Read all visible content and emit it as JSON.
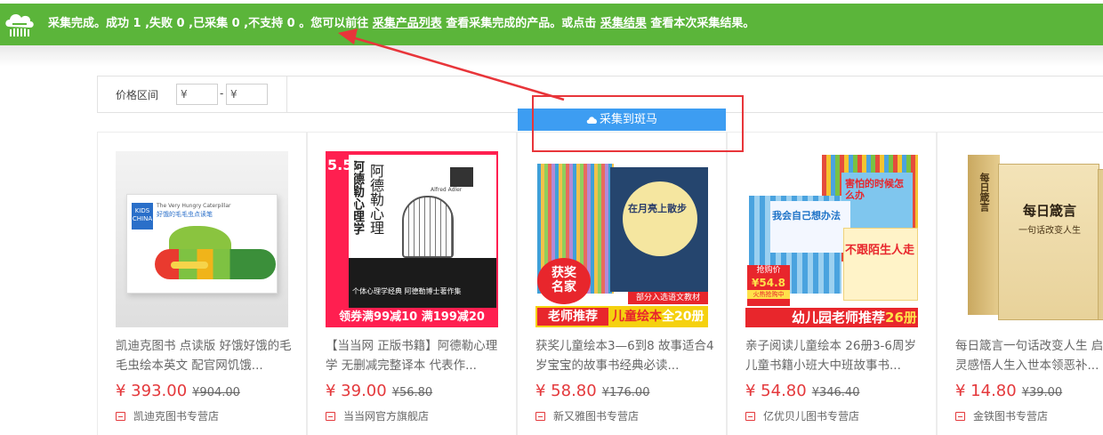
{
  "banner": {
    "msg_prefix": "采集完成。成功 1 ,失败 0 ,已采集 0 ,不支持 0 。您可以前往",
    "link_products": "采集产品列表",
    "msg_middle": "查看采集完成的产品。或点击",
    "link_results": "采集结果",
    "msg_suffix": "查看本次采集结果。"
  },
  "filter": {
    "label": "价格区间",
    "min_placeholder": "¥",
    "max_placeholder": "¥",
    "separator": "-"
  },
  "collect_button": {
    "label": "采集到斑马",
    "icon": "cloud-icon"
  },
  "colors": {
    "banner_green": "#5bb53a",
    "button_blue": "#3d9df2",
    "price_red": "#e4393c",
    "annotation_red": "#e8353a"
  },
  "products": [
    {
      "title": "凯迪克图书 点读版 好饿好饿的毛毛虫绘本英文 配官网饥饿...",
      "price": "¥ 393.00",
      "old_price": "¥904.00",
      "shop": "凯迪克图书专营店",
      "cover": {
        "brand": "KIDS CHINA",
        "book": "The Very Hungry Caterpillar",
        "book_cn": "好饿的毛毛虫点读笔"
      }
    },
    {
      "title": "【当当网 正版书籍】阿德勒心理学 无删减完整译本 代表作...",
      "price": "¥ 39.00",
      "old_price": "¥56.80",
      "shop": "当当网官方旗舰店",
      "cover": {
        "badge": "5.5",
        "title_v": "阿德勒心理学",
        "author": "Alfred Adler",
        "tag1": "个体心理学经典 阿德勒博士著作集",
        "banner": "领券满99减10 满199减20"
      }
    },
    {
      "title": "获奖儿童绘本3—6到8 故事适合4岁宝宝的故事书经典必读...",
      "price": "¥ 58.80",
      "old_price": "¥176.00",
      "shop": "新又雅图书专营店",
      "cover": {
        "book": "在月亮上散步",
        "award": "获奖名家",
        "ribbon": "部分入选语文教材",
        "left": "老师推荐",
        "right_a": "儿童绘本",
        "right_b": "全20册"
      }
    },
    {
      "title": "亲子阅读儿童绘本 26册3-6周岁儿童书籍小班大中班故事书...",
      "price": "¥ 54.80",
      "old_price": "¥346.40",
      "shop": "亿优贝儿图书专营店",
      "cover": {
        "book1": "害怕的时候怎么办",
        "book2": "我会自己想办法",
        "book3": "不跟陌生人走",
        "deal_label": "抢购价",
        "deal_price": "¥54.8",
        "deal_note": "火热抢购中",
        "bottom": "幼儿园老师推荐",
        "count": "26册"
      }
    },
    {
      "title": "每日箴言一句话改变人生 启迪心灵感悟人生入世本领恶补...",
      "price": "¥ 14.80",
      "old_price": "¥39.00",
      "shop": "金铁图书专营店",
      "cover": {
        "title": "每日箴言",
        "subtitle": "一句话改变人生",
        "spine": "每日箴言"
      }
    }
  ]
}
